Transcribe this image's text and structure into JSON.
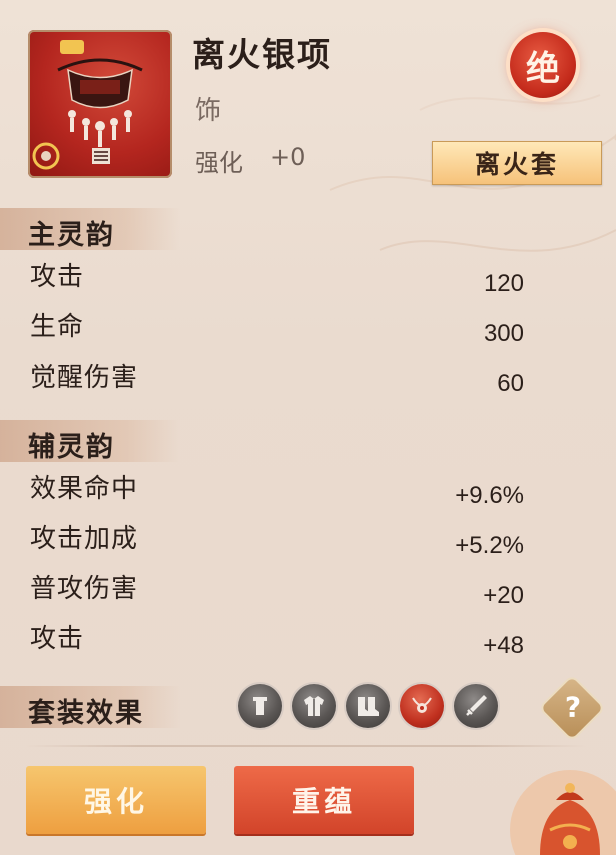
{
  "item": {
    "name": "离火银项",
    "type": "饰",
    "enhance_label": "强化",
    "enhance_value": "+0",
    "rarity": "绝",
    "set_name": "离火套",
    "icon": "necklace-icon"
  },
  "main_stats": {
    "title": "主灵韵",
    "rows": [
      {
        "name": "攻击",
        "value": "120"
      },
      {
        "name": "生命",
        "value": "300"
      },
      {
        "name": "觉醒伤害",
        "value": "60"
      }
    ]
  },
  "sub_stats": {
    "title": "辅灵韵",
    "rows": [
      {
        "name": "效果命中",
        "value": "+9.6%"
      },
      {
        "name": "攻击加成",
        "value": "+5.2%"
      },
      {
        "name": "普攻伤害",
        "value": "+20"
      },
      {
        "name": "攻击",
        "value": "+48"
      }
    ]
  },
  "set_effect": {
    "title": "套装效果",
    "pieces": [
      {
        "icon": "helmet-icon",
        "active": false
      },
      {
        "icon": "armor-icon",
        "active": false
      },
      {
        "icon": "boots-icon",
        "active": false
      },
      {
        "icon": "necklace-icon",
        "active": true
      },
      {
        "icon": "sword-icon",
        "active": false
      }
    ],
    "help_symbol": "?"
  },
  "buttons": {
    "enhance": "强化",
    "reroll": "重蕴"
  },
  "colors": {
    "accent_red": "#c42a1b",
    "accent_gold": "#f0a446",
    "background": "#eadbcf"
  }
}
